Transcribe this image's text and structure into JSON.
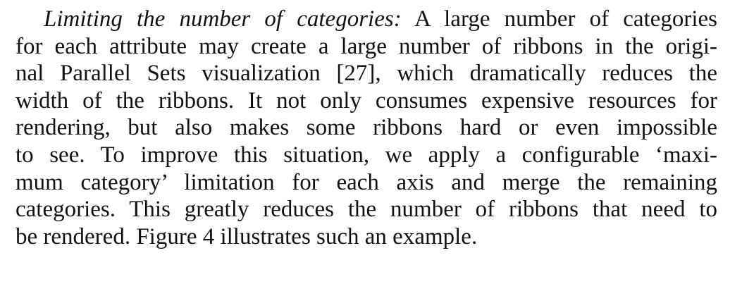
{
  "paragraph": {
    "heading": "Limiting the number of categories:",
    "lines": [
      " A large number of categories",
      "for each attribute may create a large number of ribbons in the origi-",
      "nal Parallel Sets visualization [27], which dramatically reduces the",
      "width of the ribbons. It not only consumes expensive resources for",
      "rendering, but also makes some ribbons hard or even impossible",
      "to see. To improve this situation, we apply a configurable ‘maxi-",
      "mum category’ limitation for each axis and merge the remaining",
      "categories. This greatly reduces the number of ribbons that need to",
      "be rendered. Figure 4 illustrates such an example."
    ]
  }
}
